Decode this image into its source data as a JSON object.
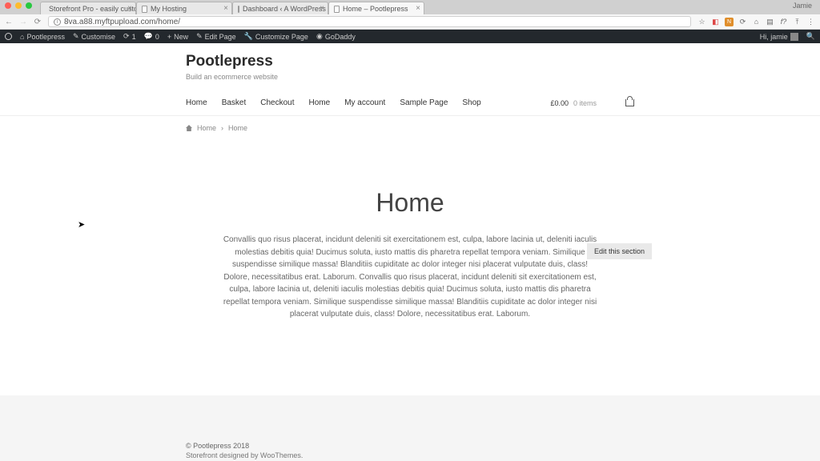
{
  "browser": {
    "macUser": "Jamie",
    "tabs": [
      {
        "label": "Storefront Pro - easily custom",
        "active": false
      },
      {
        "label": "My Hosting",
        "active": false
      },
      {
        "label": "Dashboard ‹ A WordPress Sit",
        "active": false
      },
      {
        "label": "Home – Pootlepress",
        "active": true
      }
    ],
    "url": "8va.a88.myftpupload.com/home/"
  },
  "adminbar": {
    "siteName": "Pootlepress",
    "customise": "Customise",
    "updates": "1",
    "comments": "0",
    "new": "New",
    "editPage": "Edit Page",
    "customizePage": "Customize Page",
    "goDaddy": "GoDaddy",
    "greeting": "Hi, jamie"
  },
  "site": {
    "title": "Pootlepress",
    "tagline": "Build an ecommerce website",
    "menu": [
      "Home",
      "Basket",
      "Checkout",
      "Home",
      "My account",
      "Sample Page",
      "Shop"
    ],
    "cartTotal": "£0.00",
    "cartItems": "0 items"
  },
  "breadcrumb": {
    "home": "Home",
    "current": "Home"
  },
  "editSection": "Edit this section",
  "content": {
    "heading": "Home",
    "body": "Convallis quo risus placerat, incidunt deleniti sit exercitationem est, culpa, labore lacinia ut, deleniti iaculis molestias debitis quia! Ducimus soluta, iusto mattis dis pharetra repellat tempora veniam. Similique suspendisse similique massa! Blanditiis cupiditate ac dolor integer nisi placerat vulputate duis, class! Dolore, necessitatibus erat. Laborum. Convallis quo risus placerat, incidunt deleniti sit exercitationem est, culpa, labore lacinia ut, deleniti iaculis molestias debitis quia! Ducimus soluta, iusto mattis dis pharetra repellat tempora veniam. Similique suspendisse similique massa! Blanditiis cupiditate ac dolor integer nisi placerat vulputate duis, class! Dolore, necessitatibus erat. Laborum."
  },
  "footer": {
    "copyright": "© Pootlepress 2018",
    "credit": "Storefront designed by WooThemes."
  }
}
